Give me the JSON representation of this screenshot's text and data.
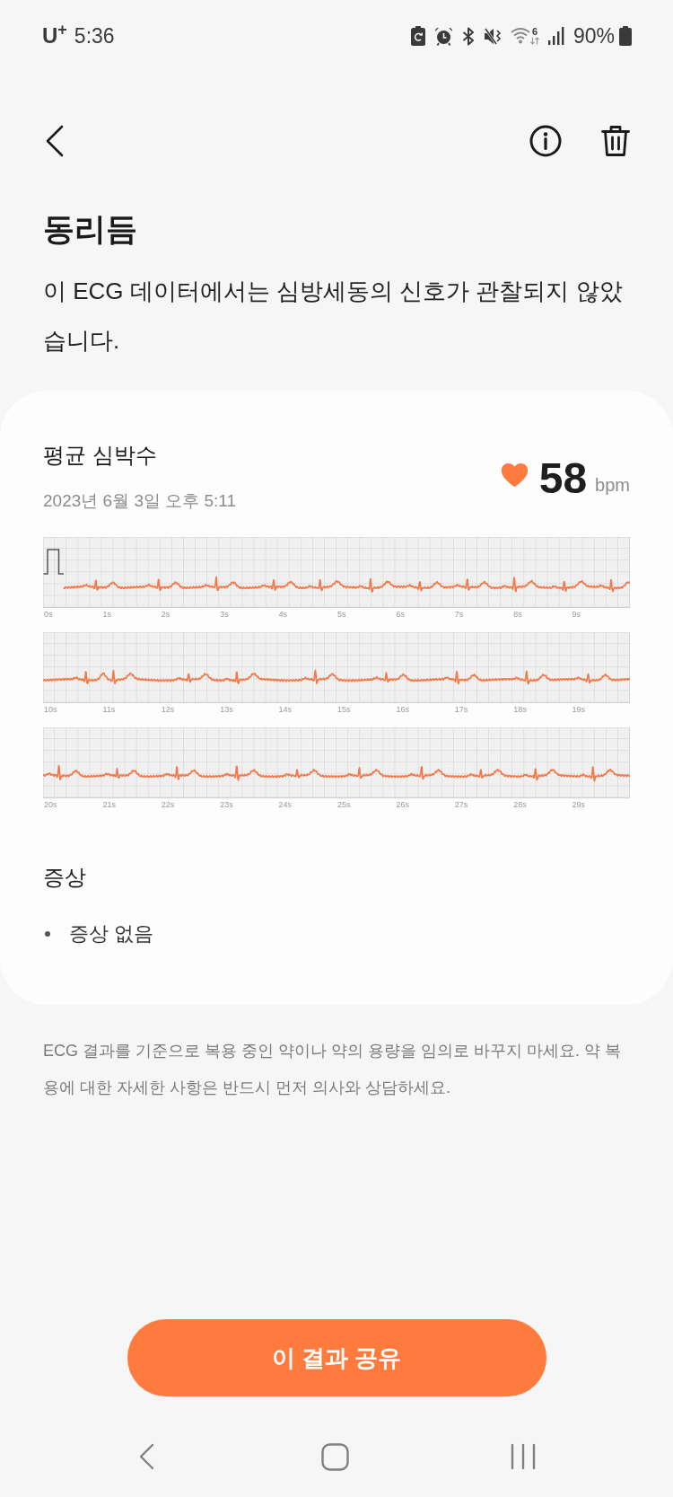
{
  "status_bar": {
    "carrier": "U$^{+}$",
    "time": "5:36",
    "wifi_generation": "6",
    "battery": "90%"
  },
  "header": {
    "title": "동리듬",
    "description": "이 ECG 데이터에서는 심방세동의 신호가 관찰되지 않았습니다."
  },
  "summary": {
    "label": "평균 심박수",
    "recorded_at": "2023년 6월 3일 오후 5:11",
    "heart_rate": "58",
    "unit": "bpm"
  },
  "ecg_strips": [
    {
      "calibration_pulse": true,
      "time_labels": [
        "0s",
        "1s",
        "2s",
        "3s",
        "4s",
        "5s",
        "6s",
        "7s",
        "8s",
        "9s"
      ]
    },
    {
      "calibration_pulse": false,
      "time_labels": [
        "10s",
        "11s",
        "12s",
        "13s",
        "14s",
        "15s",
        "16s",
        "17s",
        "18s",
        "19s"
      ]
    },
    {
      "calibration_pulse": false,
      "time_labels": [
        "20s",
        "21s",
        "22s",
        "23s",
        "24s",
        "25s",
        "26s",
        "27s",
        "28s",
        "29s"
      ]
    }
  ],
  "symptoms": {
    "title": "증상",
    "items": [
      "증상 없음"
    ]
  },
  "disclaimer": "ECG 결과를 기준으로 복용 중인 약이나 약의 용량을 임의로 바꾸지 마세요. 약 복용에 대한 자세한 사항은 반드시 먼저 의사와 상담하세요.",
  "share_button": "이 결과 공유"
}
